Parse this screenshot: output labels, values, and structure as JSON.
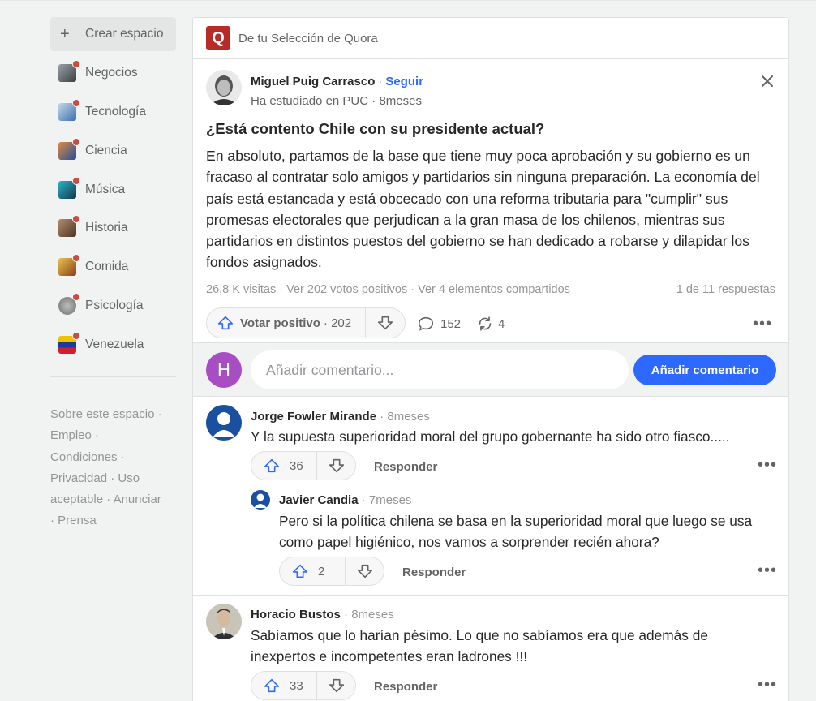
{
  "sidebar": {
    "create_label": "Crear espacio",
    "spaces": [
      {
        "label": "Negocios",
        "color": "#6b6f73",
        "icon": "negocios-thumb"
      },
      {
        "label": "Tecnología",
        "color": "#3a6fb0",
        "icon": "tecnologia-thumb"
      },
      {
        "label": "Ciencia",
        "color": "#1f4fa0",
        "icon": "ciencia-thumb"
      },
      {
        "label": "Música",
        "color": "#1f6f8b",
        "icon": "musica-thumb"
      },
      {
        "label": "Historia",
        "color": "#7a5a44",
        "icon": "historia-thumb"
      },
      {
        "label": "Comida",
        "color": "#c08a2a",
        "icon": "comida-thumb"
      },
      {
        "label": "Psicología",
        "color": "#8a8a8a",
        "icon": "psicologia-thumb"
      },
      {
        "label": "Venezuela",
        "color": "#f2c200",
        "icon": "venezuela-flag"
      }
    ],
    "footer": {
      "about": "Sobre este espacio",
      "jobs": "Empleo",
      "terms": "Condiciones",
      "privacy": "Privacidad",
      "acceptable_use": "Uso aceptable",
      "advertise": "Anunciar",
      "press": "Prensa",
      "separator": "·"
    }
  },
  "feed": {
    "source_label": "De tu Selección de Quora",
    "logo_letter": "Q",
    "colors": {
      "brand": "#b92b27",
      "accent": "#2e69ff",
      "avatar_h": "#a64ec2"
    }
  },
  "post": {
    "author": "Miguel Puig Carrasco",
    "follow_label": "Seguir",
    "separator": "·",
    "credential": "Ha estudiado en PUC",
    "time": "8meses",
    "question": "¿Está contento Chile con su presidente actual?",
    "answer": "En absoluto, partamos de la base que tiene muy poca aprobación y su gobierno es un fracaso al contratar solo amigos y partidarios sin ninguna preparación. La economía del país está estancada y está obcecado con una reforma tributaria para \"cumplir\" sus promesas electorales que perjudican a la gran masa de los chilenos, mientras sus partidarios en distintos puestos del gobierno se han dedicado a robarse y dilapidar los fondos asignados.",
    "stats": "26,8 K visitas · Ver 202 votos positivos · Ver 4 elementos compartidos",
    "response_index": "1 de 11 respuestas",
    "upvote_label": "Votar positivo",
    "upvote_count_text": "· 202",
    "comment_count": "152",
    "share_count": "4"
  },
  "comment_box": {
    "avatar_letter": "H",
    "placeholder": "Añadir comentario...",
    "button_label": "Añadir comentario"
  },
  "comments": [
    {
      "author": "Jorge Fowler Mirande",
      "time": "· 8meses",
      "text": "Y la supuesta superioridad moral del grupo gobernante ha sido otro fiasco.....",
      "votes": "36",
      "reply_label": "Responder"
    },
    {
      "author": "Javier Candia",
      "time": "· 7meses",
      "text": "Pero si la política chilena se basa en la superioridad moral que luego se usa como papel higiénico, nos vamos a sorprender recién ahora?",
      "votes": "2",
      "reply_label": "Responder"
    },
    {
      "author": "Horacio Bustos",
      "time": "· 8meses",
      "text": "Sabíamos que lo harían pésimo. Lo que no sabíamos era que además de inexpertos e incompetentes eran ladrones !!!",
      "votes": "33",
      "reply_label": "Responder"
    }
  ]
}
